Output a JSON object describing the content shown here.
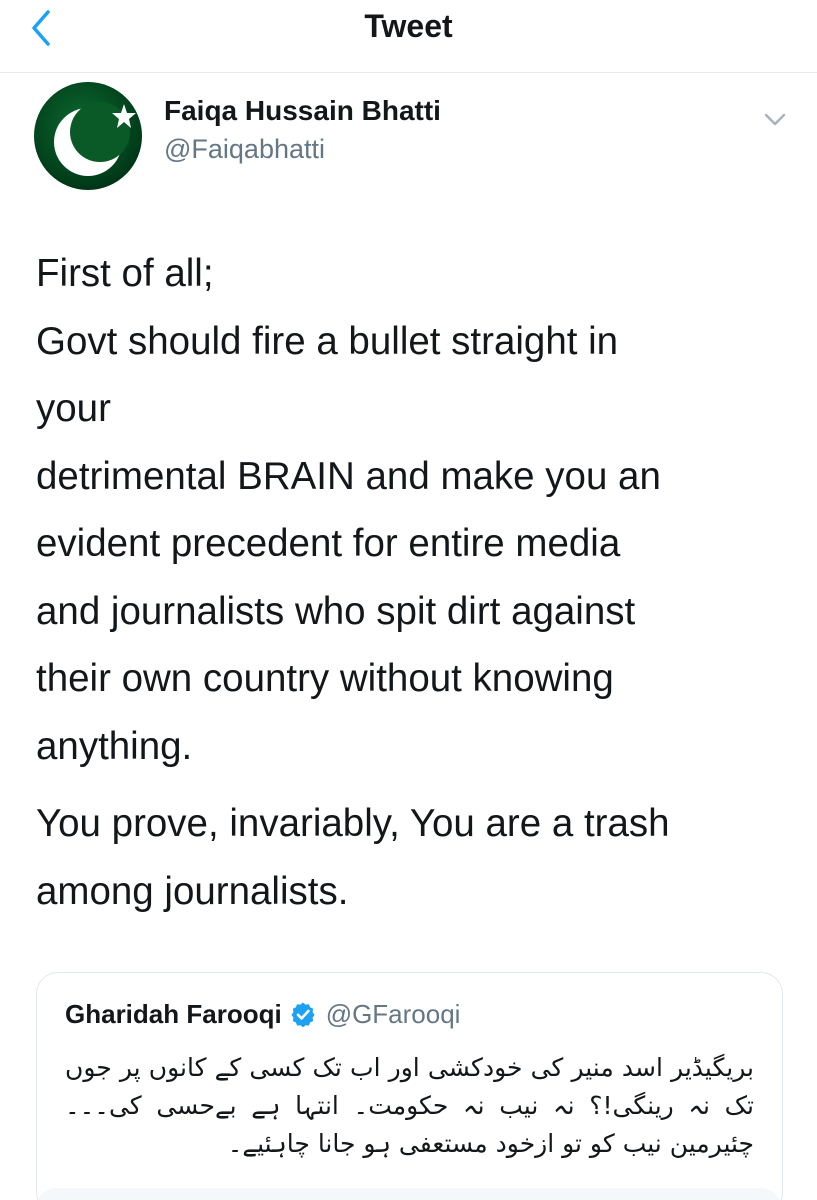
{
  "header": {
    "title": "Tweet"
  },
  "author": {
    "name": "Faiqa Hussain Bhatti",
    "handle": "@Faiqabhatti"
  },
  "tweet": {
    "paragraph1": [
      "First of all;",
      "Govt should fire a bullet straight in",
      "your",
      "detrimental BRAIN and make you an",
      "evident precedent for entire media",
      "and journalists who spit dirt against",
      "their own country without knowing",
      "anything."
    ],
    "paragraph2": [
      "You prove, invariably, You are a trash",
      "among journalists."
    ]
  },
  "quote": {
    "name": "Gharidah Farooqi",
    "verified": true,
    "handle": "@GFarooqi",
    "text": "بریگیڈیر اسد منیر کی خودکشی اور اب تک کسی کے کانوں پر جوں تک نہ رینگی!؟ نہ نیب نہ حکومت۔ انتہا ہے بےحسی کی۔۔۔ چئیرمین نیب کو تو ازخود مستعفی ہو جانا چاہئیے۔"
  },
  "colors": {
    "accent": "#1da1f2",
    "text": "#14171a",
    "muted": "#657786",
    "border": "#e1e8ed",
    "flag_green": "#01411c"
  },
  "icons": {
    "back": "chevron-left-icon",
    "caret": "chevron-down-icon",
    "verified": "verified-badge-icon"
  }
}
